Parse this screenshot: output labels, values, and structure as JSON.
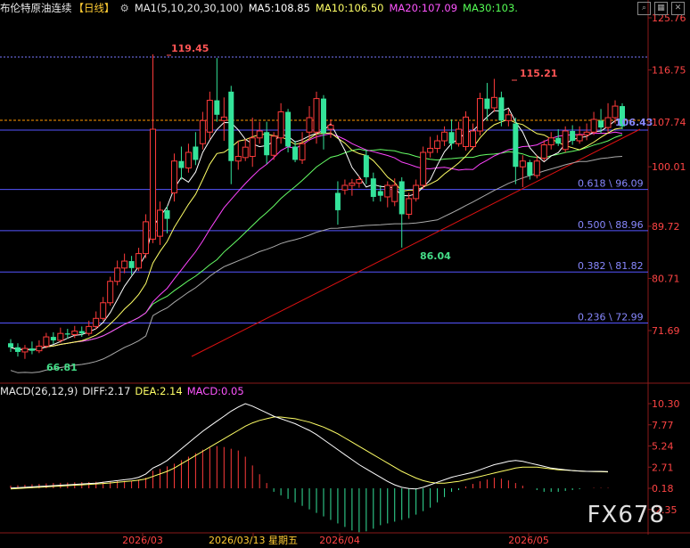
{
  "header": {
    "title": "布伦特原油连续",
    "period": "【日线】",
    "ma_label": "MA1(5,10,20,30,100)",
    "ma5": "MA5:108.85",
    "ma10": "MA10:106.50",
    "ma20": "MA20:107.09",
    "ma30": "MA30:103.",
    "settings_icon": "gear-icon",
    "window_icons": [
      "search-icon",
      "grid-icon",
      "close-icon"
    ]
  },
  "macd_header": {
    "label": "MACD(26,12,9)",
    "diff": "DIFF:2.17",
    "dea": "DEA:2.14",
    "macd": "MACD:0.05"
  },
  "watermark": "FX678",
  "colors": {
    "up": "#ff3b3b",
    "down": "#34e39a",
    "ma5": "#ffffff",
    "ma10": "#ffff66",
    "ma20": "#ff44ff",
    "ma30": "#66ff66",
    "ma100": "#aaaaaa",
    "fib": "#5555ff",
    "trend": "#dd1111",
    "dashed": "#ff9900"
  },
  "chart_data": {
    "type": "candlestick",
    "price_axis_ticks": [
      "125.76",
      "116.75",
      "107.74",
      "100.01",
      "89.72",
      "80.71",
      "71.69"
    ],
    "macd_axis_ticks": [
      "10.30",
      "7.77",
      "5.24",
      "2.71",
      "0.18",
      "-2.35"
    ],
    "x_labels": [
      "2026/03",
      "2026/03/13 星期五",
      "2026/04",
      "2026/05"
    ],
    "annotations": [
      {
        "text": "119.45",
        "color": "#ff5555",
        "type": "high"
      },
      {
        "text": "115.21",
        "color": "#ff5555",
        "type": "high"
      },
      {
        "text": "86.04",
        "color": "#44dd88",
        "type": "low"
      },
      {
        "text": "66.81",
        "color": "#44dd88",
        "type": "low"
      },
      {
        "text": "106.43",
        "color": "#8888ff",
        "type": "last"
      }
    ],
    "fib_levels": [
      {
        "label": "0.618 \\ 96.09",
        "value": 96.09
      },
      {
        "label": "0.500 \\ 88.96",
        "value": 88.96
      },
      {
        "label": "0.382 \\ 81.82",
        "value": 81.82
      },
      {
        "label": "0.236 \\ 72.99",
        "value": 72.99
      }
    ],
    "candles": [
      {
        "o": 69.5,
        "c": 68.8,
        "h": 70.2,
        "l": 68.0
      },
      {
        "o": 68.8,
        "c": 68.0,
        "h": 69.5,
        "l": 67.2
      },
      {
        "o": 68.0,
        "c": 68.6,
        "h": 69.2,
        "l": 66.8
      },
      {
        "o": 68.6,
        "c": 68.2,
        "h": 69.8,
        "l": 67.6
      },
      {
        "o": 68.2,
        "c": 69.0,
        "h": 70.0,
        "l": 67.8
      },
      {
        "o": 69.0,
        "c": 70.6,
        "h": 71.3,
        "l": 68.6
      },
      {
        "o": 70.6,
        "c": 70.0,
        "h": 71.4,
        "l": 69.4
      },
      {
        "o": 70.0,
        "c": 71.2,
        "h": 72.2,
        "l": 69.6
      },
      {
        "o": 71.2,
        "c": 71.0,
        "h": 72.0,
        "l": 70.3
      },
      {
        "o": 71.0,
        "c": 71.6,
        "h": 72.5,
        "l": 70.4
      },
      {
        "o": 71.6,
        "c": 71.2,
        "h": 72.4,
        "l": 70.6
      },
      {
        "o": 71.2,
        "c": 72.4,
        "h": 73.4,
        "l": 70.8
      },
      {
        "o": 72.4,
        "c": 73.8,
        "h": 75.0,
        "l": 71.9
      },
      {
        "o": 73.8,
        "c": 76.5,
        "h": 77.5,
        "l": 73.4
      },
      {
        "o": 76.5,
        "c": 80.2,
        "h": 81.0,
        "l": 76.0
      },
      {
        "o": 80.2,
        "c": 82.5,
        "h": 83.8,
        "l": 79.5
      },
      {
        "o": 82.5,
        "c": 83.7,
        "h": 85.0,
        "l": 81.6
      },
      {
        "o": 83.7,
        "c": 82.5,
        "h": 84.6,
        "l": 81.3
      },
      {
        "o": 82.5,
        "c": 85.0,
        "h": 86.0,
        "l": 82.0
      },
      {
        "o": 85.0,
        "c": 90.5,
        "h": 91.8,
        "l": 84.2
      },
      {
        "o": 87.5,
        "c": 106.5,
        "h": 119.45,
        "l": 86.8
      },
      {
        "o": 88.0,
        "c": 92.5,
        "h": 94.0,
        "l": 86.5
      },
      {
        "o": 92.5,
        "c": 91.0,
        "h": 93.2,
        "l": 88.5
      },
      {
        "o": 95.5,
        "c": 101.0,
        "h": 102.3,
        "l": 94.0
      },
      {
        "o": 101.0,
        "c": 99.8,
        "h": 103.5,
        "l": 97.8
      },
      {
        "o": 99.8,
        "c": 102.5,
        "h": 104.0,
        "l": 99.0
      },
      {
        "o": 103.5,
        "c": 101.2,
        "h": 106.0,
        "l": 100.3
      },
      {
        "o": 104.0,
        "c": 108.0,
        "h": 109.5,
        "l": 103.0
      },
      {
        "o": 106.0,
        "c": 111.5,
        "h": 113.0,
        "l": 104.8
      },
      {
        "o": 111.5,
        "c": 109.0,
        "h": 118.8,
        "l": 107.8
      },
      {
        "o": 108.0,
        "c": 108.6,
        "h": 112.0,
        "l": 104.5
      },
      {
        "o": 113.0,
        "c": 101.0,
        "h": 114.0,
        "l": 97.0
      },
      {
        "o": 101.0,
        "c": 101.8,
        "h": 104.5,
        "l": 99.5
      },
      {
        "o": 101.6,
        "c": 103.4,
        "h": 104.8,
        "l": 101.0
      },
      {
        "o": 101.8,
        "c": 105.0,
        "h": 108.5,
        "l": 100.0
      },
      {
        "o": 105.0,
        "c": 106.2,
        "h": 107.8,
        "l": 104.0
      },
      {
        "o": 106.0,
        "c": 102.0,
        "h": 107.8,
        "l": 100.5
      },
      {
        "o": 102.0,
        "c": 105.3,
        "h": 106.0,
        "l": 101.2
      },
      {
        "o": 105.0,
        "c": 109.5,
        "h": 111.0,
        "l": 104.0
      },
      {
        "o": 109.5,
        "c": 103.5,
        "h": 110.0,
        "l": 102.5
      },
      {
        "o": 103.5,
        "c": 101.2,
        "h": 104.5,
        "l": 100.8
      },
      {
        "o": 101.2,
        "c": 104.0,
        "h": 106.0,
        "l": 100.5
      },
      {
        "o": 106.0,
        "c": 108.5,
        "h": 110.5,
        "l": 104.5
      },
      {
        "o": 106.0,
        "c": 111.8,
        "h": 113.0,
        "l": 104.0
      },
      {
        "o": 111.8,
        "c": 105.8,
        "h": 112.4,
        "l": 103.0
      },
      {
        "o": 106.5,
        "c": 107.2,
        "h": 108.2,
        "l": 105.0
      },
      {
        "o": 95.5,
        "c": 92.5,
        "h": 97.5,
        "l": 90.0
      },
      {
        "o": 96.0,
        "c": 96.8,
        "h": 97.8,
        "l": 95.2
      },
      {
        "o": 96.8,
        "c": 97.2,
        "h": 97.9,
        "l": 95.0
      },
      {
        "o": 97.2,
        "c": 97.8,
        "h": 98.4,
        "l": 96.4
      },
      {
        "o": 102.0,
        "c": 98.2,
        "h": 103.0,
        "l": 97.0
      },
      {
        "o": 98.0,
        "c": 94.8,
        "h": 99.0,
        "l": 94.0
      },
      {
        "o": 95.8,
        "c": 95.0,
        "h": 96.8,
        "l": 94.0
      },
      {
        "o": 94.8,
        "c": 96.8,
        "h": 97.5,
        "l": 93.0
      },
      {
        "o": 94.0,
        "c": 96.8,
        "h": 98.0,
        "l": 93.2
      },
      {
        "o": 97.5,
        "c": 91.8,
        "h": 98.2,
        "l": 86.04
      },
      {
        "o": 91.8,
        "c": 94.5,
        "h": 95.5,
        "l": 91.0
      },
      {
        "o": 94.5,
        "c": 96.8,
        "h": 97.8,
        "l": 94.0
      },
      {
        "o": 96.8,
        "c": 102.5,
        "h": 103.5,
        "l": 96.2
      },
      {
        "o": 102.5,
        "c": 103.2,
        "h": 105.2,
        "l": 101.6
      },
      {
        "o": 103.2,
        "c": 104.5,
        "h": 105.5,
        "l": 102.4
      },
      {
        "o": 104.5,
        "c": 106.0,
        "h": 107.0,
        "l": 103.6
      },
      {
        "o": 106.0,
        "c": 104.0,
        "h": 108.2,
        "l": 103.0
      },
      {
        "o": 104.0,
        "c": 106.5,
        "h": 107.8,
        "l": 103.5
      },
      {
        "o": 103.5,
        "c": 108.6,
        "h": 109.6,
        "l": 102.8
      },
      {
        "o": 103.5,
        "c": 106.2,
        "h": 107.5,
        "l": 103.0
      },
      {
        "o": 106.2,
        "c": 111.8,
        "h": 112.8,
        "l": 105.4
      },
      {
        "o": 111.8,
        "c": 110.0,
        "h": 114.5,
        "l": 108.0
      },
      {
        "o": 110.2,
        "c": 112.0,
        "h": 115.21,
        "l": 109.5
      },
      {
        "o": 112.0,
        "c": 108.0,
        "h": 113.0,
        "l": 107.0
      },
      {
        "o": 108.0,
        "c": 109.0,
        "h": 110.0,
        "l": 107.0
      },
      {
        "o": 107.5,
        "c": 100.0,
        "h": 108.5,
        "l": 97.0
      },
      {
        "o": 100.0,
        "c": 101.0,
        "h": 102.0,
        "l": 96.5
      },
      {
        "o": 100.8,
        "c": 98.5,
        "h": 101.2,
        "l": 97.8
      },
      {
        "o": 98.5,
        "c": 101.0,
        "h": 102.0,
        "l": 98.0
      },
      {
        "o": 101.5,
        "c": 103.8,
        "h": 104.6,
        "l": 101.0
      },
      {
        "o": 103.8,
        "c": 105.0,
        "h": 106.0,
        "l": 103.0
      },
      {
        "o": 105.0,
        "c": 104.0,
        "h": 106.5,
        "l": 103.6
      },
      {
        "o": 103.0,
        "c": 106.2,
        "h": 107.0,
        "l": 102.5
      },
      {
        "o": 106.2,
        "c": 104.5,
        "h": 107.2,
        "l": 103.8
      },
      {
        "o": 104.5,
        "c": 105.5,
        "h": 107.0,
        "l": 104.0
      },
      {
        "o": 105.5,
        "c": 106.0,
        "h": 107.5,
        "l": 104.6
      },
      {
        "o": 106.0,
        "c": 108.2,
        "h": 109.5,
        "l": 105.5
      },
      {
        "o": 108.0,
        "c": 106.8,
        "h": 110.0,
        "l": 105.8
      },
      {
        "o": 106.8,
        "c": 108.5,
        "h": 111.0,
        "l": 106.0
      },
      {
        "o": 108.5,
        "c": 110.5,
        "h": 111.5,
        "l": 107.5
      },
      {
        "o": 110.5,
        "c": 107.0,
        "h": 111.0,
        "l": 106.5
      }
    ],
    "macd_hist": [
      0.3,
      0.35,
      0.4,
      0.45,
      0.5,
      0.55,
      0.6,
      0.62,
      0.65,
      0.68,
      0.7,
      0.72,
      0.74,
      0.76,
      0.8,
      0.82,
      0.84,
      0.86,
      1.0,
      1.2,
      2.0,
      2.2,
      2.5,
      2.8,
      3.2,
      3.6,
      4.0,
      4.4,
      4.6,
      4.8,
      4.7,
      4.5,
      4.3,
      3.6,
      2.6,
      1.6,
      0.6,
      -0.4,
      -0.8,
      -1.2,
      -1.6,
      -2.0,
      -2.4,
      -2.8,
      -3.2,
      -3.6,
      -4.0,
      -4.4,
      -4.8,
      -5.0,
      -4.9,
      -4.6,
      -4.2,
      -4.0,
      -3.8,
      -3.6,
      -3.4,
      -3.0,
      -2.6,
      -2.2,
      -1.6,
      -1.0,
      -0.4,
      -0.2,
      0.2,
      0.5,
      0.8,
      1.0,
      1.2,
      1.1,
      0.9,
      0.6,
      0.3,
      0.0,
      -0.2,
      -0.4,
      -0.4,
      -0.4,
      -0.3,
      -0.2,
      -0.1,
      0.0,
      0.05,
      0.05,
      0.05
    ],
    "macd_diff": [
      0.2,
      0.25,
      0.3,
      0.35,
      0.4,
      0.45,
      0.5,
      0.55,
      0.6,
      0.65,
      0.7,
      0.75,
      0.8,
      0.9,
      1.0,
      1.1,
      1.2,
      1.3,
      1.5,
      1.9,
      2.6,
      3.0,
      3.5,
      4.2,
      4.9,
      5.6,
      6.3,
      7.0,
      7.6,
      8.2,
      8.8,
      9.4,
      9.9,
      10.3,
      10.0,
      9.6,
      9.2,
      8.8,
      8.5,
      8.2,
      7.9,
      7.5,
      7.1,
      6.6,
      6.0,
      5.4,
      4.8,
      4.2,
      3.6,
      3.0,
      2.5,
      2.0,
      1.5,
      1.0,
      0.6,
      0.3,
      0.15,
      0.1,
      0.3,
      0.6,
      0.9,
      1.2,
      1.5,
      1.7,
      1.9,
      2.1,
      2.4,
      2.7,
      3.0,
      3.2,
      3.4,
      3.5,
      3.4,
      3.2,
      3.0,
      2.8,
      2.6,
      2.5,
      2.4,
      2.3,
      2.25,
      2.2,
      2.2,
      2.2,
      2.17
    ],
    "macd_dea": [
      0.1,
      0.15,
      0.2,
      0.25,
      0.3,
      0.35,
      0.4,
      0.45,
      0.5,
      0.55,
      0.6,
      0.65,
      0.7,
      0.75,
      0.82,
      0.9,
      0.98,
      1.05,
      1.15,
      1.3,
      1.6,
      1.9,
      2.2,
      2.6,
      3.1,
      3.6,
      4.1,
      4.6,
      5.1,
      5.6,
      6.1,
      6.6,
      7.1,
      7.6,
      8.0,
      8.3,
      8.5,
      8.7,
      8.7,
      8.6,
      8.5,
      8.3,
      8.1,
      7.8,
      7.5,
      7.1,
      6.7,
      6.2,
      5.7,
      5.2,
      4.7,
      4.2,
      3.7,
      3.2,
      2.7,
      2.2,
      1.8,
      1.4,
      1.1,
      0.9,
      0.8,
      0.8,
      0.9,
      1.0,
      1.2,
      1.4,
      1.6,
      1.8,
      2.0,
      2.2,
      2.4,
      2.6,
      2.7,
      2.7,
      2.7,
      2.6,
      2.5,
      2.4,
      2.35,
      2.3,
      2.25,
      2.2,
      2.18,
      2.16,
      2.14
    ]
  }
}
